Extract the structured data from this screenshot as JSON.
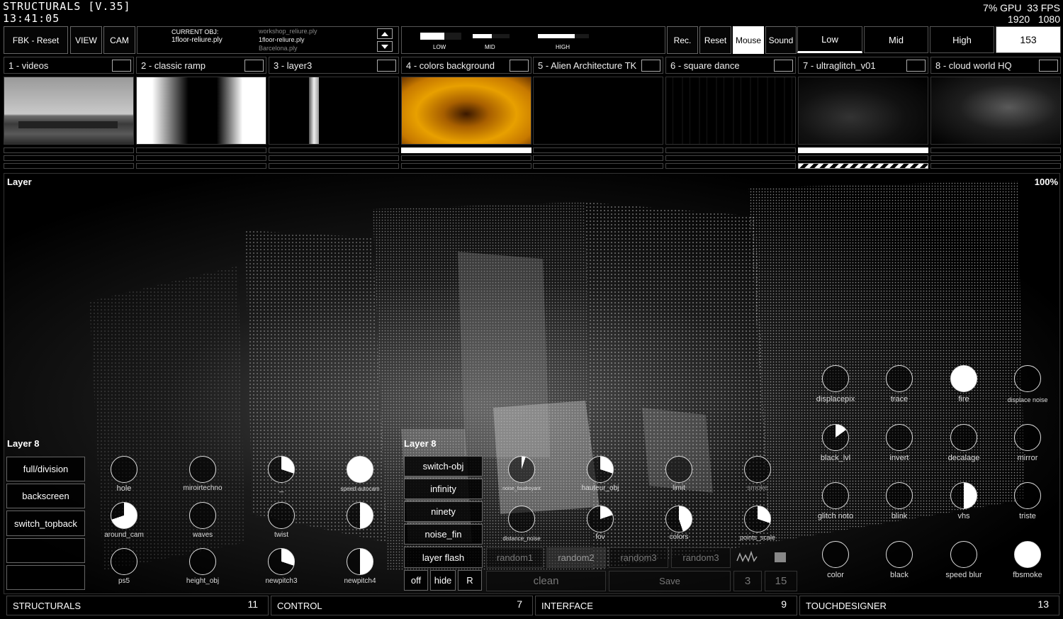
{
  "app": {
    "title": "STRUCTURALS [V.35]",
    "clock": "13:41:05"
  },
  "perf": {
    "gpu": "7% GPU",
    "fps": "33 FPS",
    "res_w": "1920",
    "res_h": "1080"
  },
  "toolbar": {
    "fbk_reset": "FBK - Reset",
    "view": "VIEW",
    "cam": "CAM"
  },
  "obj": {
    "label": "CURRENT OBJ:",
    "current": "1floor-reliure.ply",
    "list": [
      "workshop_reliure.ply",
      "1floor-reliure.ply",
      "Barcelona.ply"
    ]
  },
  "levels": {
    "low": "LOW",
    "mid": "MID",
    "high": "HIGH",
    "low_fill": 0.58,
    "mid_fill": 0.52,
    "high_fill": 0.72
  },
  "rec": {
    "rec": "Rec.",
    "reset": "Reset",
    "mouse": "Mouse",
    "sound": "Sound"
  },
  "bands": {
    "low": "Low",
    "mid": "Mid",
    "high": "High",
    "value": "153"
  },
  "layers": [
    {
      "label": "1 - videos"
    },
    {
      "label": "2 - classic ramp"
    },
    {
      "label": "3 - layer3"
    },
    {
      "label": "4 - colors background"
    },
    {
      "label": "5 - Alien Architecture TK"
    },
    {
      "label": "6 - square dance"
    },
    {
      "label": "7 - ultraglitch_v01"
    },
    {
      "label": "8 - cloud world HQ"
    }
  ],
  "viewport": {
    "title": "Layer",
    "zoom": "100%"
  },
  "panel1": {
    "title": "Layer 8",
    "buttons": [
      "full/division",
      "backscreen",
      "switch_topback",
      "",
      ""
    ]
  },
  "knobsA": [
    {
      "label": "hole",
      "value": 0
    },
    {
      "label": "miroirtechno",
      "value": 0
    },
    {
      "label": "_",
      "value": 0.3
    },
    {
      "label": "speed-autocam",
      "value": 1
    },
    {
      "label": "around_cam",
      "value": 0.7
    },
    {
      "label": "waves",
      "value": 0
    },
    {
      "label": "twist",
      "value": 0
    },
    {
      "label": "",
      "value": 0.5
    },
    {
      "label": "ps5",
      "value": 0
    },
    {
      "label": "height_obj",
      "value": 0
    },
    {
      "label": "newpitch3",
      "value": 0.3
    },
    {
      "label": "newpitch4",
      "value": 0.5
    }
  ],
  "panel2": {
    "title": "Layer 8",
    "buttons": [
      "switch-obj",
      "infinity",
      "ninety",
      "noise_fin",
      "layer flash"
    ],
    "off": "off",
    "hide": "hide",
    "r": "R"
  },
  "knobsB": [
    {
      "label": "noise_foudroyant",
      "value": 0.05
    },
    {
      "label": "hauteur_obj",
      "value": 0.3
    },
    {
      "label": "limit",
      "value": 0
    },
    {
      "label": "smoke",
      "value": 0
    },
    {
      "label": "distance_noise",
      "value": 0
    },
    {
      "label": "fov",
      "value": 0.2
    },
    {
      "label": "colors",
      "value": 0.45
    },
    {
      "label": "points_scale",
      "value": 0.3
    }
  ],
  "random": {
    "r1": "random1",
    "r2": "random2",
    "r3": "random3",
    "r4": "random3",
    "clean": "clean",
    "save": "Save",
    "n3": "3",
    "n15": "15"
  },
  "knobsC": [
    {
      "label": "displacepix",
      "value": 0
    },
    {
      "label": "trace",
      "value": 0
    },
    {
      "label": "fire",
      "value": 1
    },
    {
      "label": "displace noise",
      "value": 0
    },
    {
      "label": "black_lvl",
      "value": 0.15
    },
    {
      "label": "invert",
      "value": 0
    },
    {
      "label": "decalage",
      "value": 0
    },
    {
      "label": "mirror",
      "value": 0
    },
    {
      "label": "glitch noto",
      "value": 0
    },
    {
      "label": "blink",
      "value": 0
    },
    {
      "label": "vhs",
      "value": 0.5
    },
    {
      "label": "triste",
      "value": 0
    },
    {
      "label": "color",
      "value": 0
    },
    {
      "label": "black",
      "value": 0
    },
    {
      "label": "speed blur",
      "value": 0
    },
    {
      "label": "fbsmoke",
      "value": 1
    }
  ],
  "footer": [
    {
      "label": "STRUCTURALS",
      "count": "11"
    },
    {
      "label": "CONTROL",
      "count": "7"
    },
    {
      "label": "INTERFACE",
      "count": "9"
    },
    {
      "label": "TOUCHDESIGNER",
      "count": "13"
    }
  ]
}
